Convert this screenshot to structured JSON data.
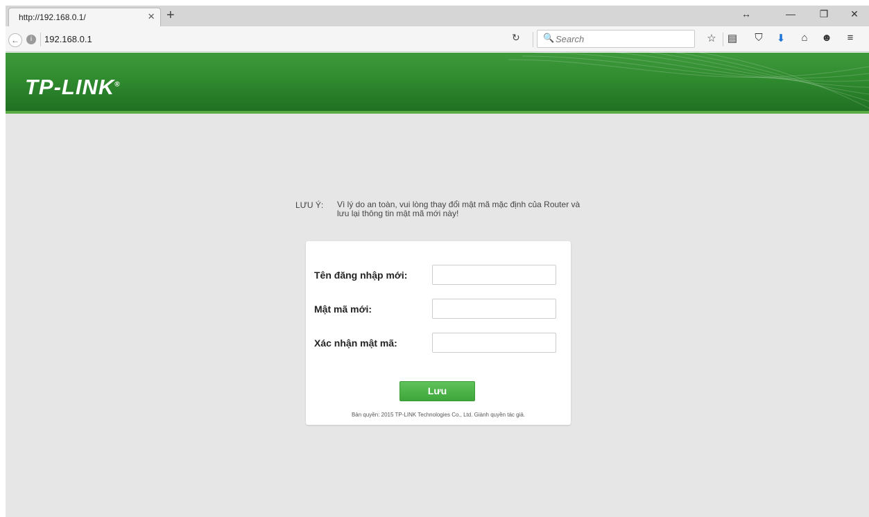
{
  "browser": {
    "tab_title": "http://192.168.0.1/",
    "url": "192.168.0.1",
    "search_placeholder": "Search"
  },
  "page": {
    "logo": "TP-LINK",
    "logo_mark": "®",
    "notice_label": "LƯU Ý:",
    "notice_text": "Vì lý do an toàn, vui lòng thay đổi mật mã mặc định của Router và lưu lại thông tin mật mã mới này!",
    "fields": [
      {
        "label": "Tên đăng nhập mới:",
        "value": ""
      },
      {
        "label": "Mật mã mới:",
        "value": ""
      },
      {
        "label": "Xác nhận mật mã:",
        "value": ""
      }
    ],
    "save_label": "Lưu",
    "copyright": "Bản quyền: 2015 TP-LINK Technologies Co., Ltd. Giành quyền tác giả."
  },
  "icons": {
    "close": "×",
    "new_tab": "+",
    "back": "←",
    "info": "i",
    "reload": "↻",
    "search": "🔍",
    "bookmark": "☆",
    "reading_list": "▤",
    "pocket": "⛉",
    "download": "⬇",
    "home": "⌂",
    "hello": "☻",
    "menu": "≡",
    "resize": "↔",
    "minimize": "—",
    "restore": "❐",
    "win_close": "✕"
  },
  "colors": {
    "header_green": "#2f8a2e",
    "save_green": "#4cb447",
    "page_bg": "#e6e6e6"
  }
}
